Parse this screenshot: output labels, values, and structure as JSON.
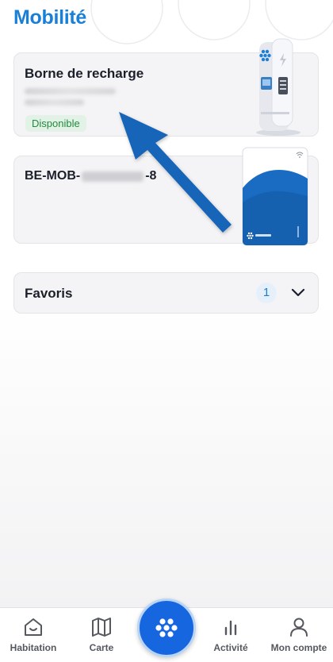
{
  "header": {
    "title": "Mobilité"
  },
  "charging_card": {
    "title": "Borne de recharge",
    "status": "Disponible"
  },
  "mobility_card": {
    "id_prefix": "BE-MOB-",
    "id_suffix": "-8"
  },
  "favorites": {
    "label": "Favoris",
    "count": "1"
  },
  "tabbar": {
    "items": [
      {
        "label": "Habitation",
        "icon": "home-icon"
      },
      {
        "label": "Carte",
        "icon": "map-icon"
      },
      {
        "label": "Activité",
        "icon": "chart-icon"
      },
      {
        "label": "Mon compte",
        "icon": "user-icon"
      }
    ],
    "center_icon": "app-logo-icon"
  },
  "colors": {
    "accent": "#1a7fd6",
    "status_green": "#218a3e",
    "fab_blue": "#1666e0",
    "annotation_arrow": "#1565b8"
  }
}
